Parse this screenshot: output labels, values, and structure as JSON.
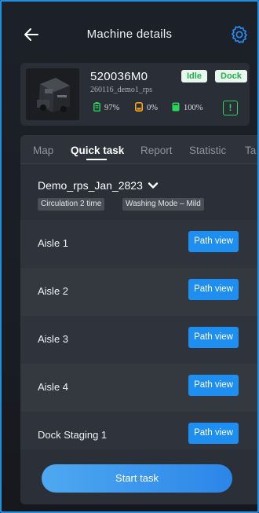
{
  "header": {
    "title": "Machine details"
  },
  "machine": {
    "id": "520036M0",
    "subtitle": "260116_demo1_rps",
    "status_badges": [
      "Idle",
      "Dock"
    ],
    "stats": {
      "battery": "97%",
      "water": "0%",
      "tank": "100%"
    },
    "alert_symbol": "!"
  },
  "tabs": [
    "Map",
    "Quick task",
    "Report",
    "Statistic",
    "Ta"
  ],
  "active_tab": "Quick task",
  "task": {
    "name": "Demo_rps_Jan_2823",
    "chips": [
      "Circulation 2 time",
      "Washing Mode – Mild"
    ]
  },
  "rows": [
    {
      "label": "Aisle 1",
      "button": "Path view"
    },
    {
      "label": "Aisle 2",
      "button": "Path view"
    },
    {
      "label": "Aisle 3",
      "button": "Path view"
    },
    {
      "label": "Aisle 4",
      "button": "Path view"
    },
    {
      "label": "Dock Staging 1",
      "button": "Path view"
    }
  ],
  "footer": {
    "start_label": "Start task"
  },
  "colors": {
    "accent": "#1f8ef1",
    "status_green": "#22b14c",
    "alert_green": "#2bd45c",
    "water_orange": "#f5a623",
    "frame_border": "#1f8fe0"
  },
  "icons": [
    "back-arrow-icon",
    "gear-icon",
    "battery-icon",
    "water-icon",
    "tank-icon",
    "alert-icon",
    "chevron-down-icon"
  ]
}
